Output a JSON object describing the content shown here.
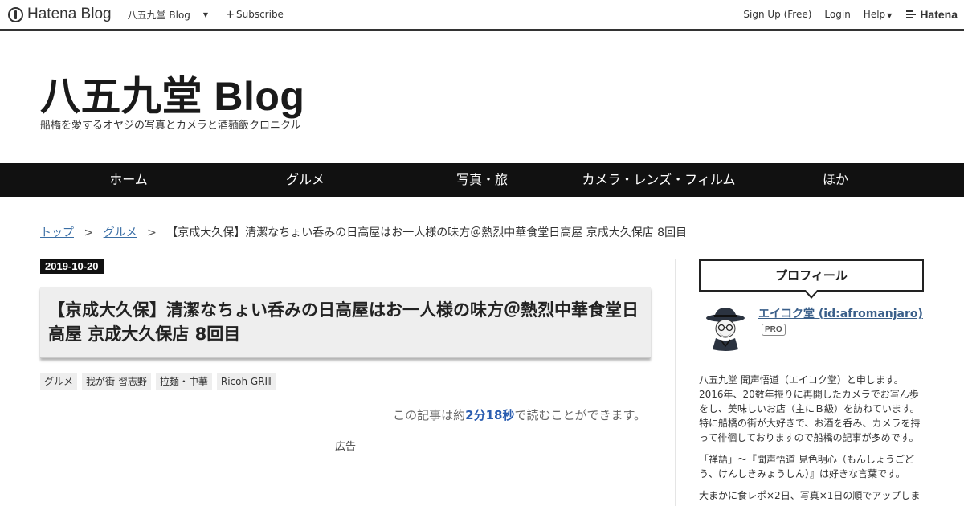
{
  "topbar": {
    "logo_text": "Hatena Blog",
    "blog_name": "八五九堂 Blog",
    "subscribe_label": "Subscribe",
    "signup_label": "Sign Up (Free)",
    "login_label": "Login",
    "help_label": "Help",
    "hatena_label": "Hatena"
  },
  "header": {
    "title": "八五九堂 Blog",
    "description": "船橋を愛するオヤジの写真とカメラと酒麺飯クロニクル"
  },
  "nav": {
    "items": [
      {
        "label": "ホーム"
      },
      {
        "label": "グルメ"
      },
      {
        "label": "写真・旅"
      },
      {
        "label": "カメラ・レンズ・フィルム"
      },
      {
        "label": "ほか"
      }
    ]
  },
  "breadcrumb": {
    "top": "トップ",
    "category": "グルメ",
    "separator": ">",
    "current": "【京成大久保】清潔なちょい呑みの日高屋はお一人様の味方＠熱烈中華食堂日高屋 京成大久保店 8回目"
  },
  "article": {
    "date": "2019-10-20",
    "title": "【京成大久保】清潔なちょい呑みの日高屋はお一人様の味方＠熱烈中華食堂日高屋 京成大久保店 8回目",
    "tags": [
      "グルメ",
      "我が街 習志野",
      "拉麺・中華",
      "Ricoh GRⅢ"
    ],
    "reading_prefix": "この記事は約",
    "reading_value": "2分18秒",
    "reading_suffix": "で読むことができます。",
    "ad_label": "広告"
  },
  "sidebar": {
    "profile_heading": "プロフィール",
    "author": "エイコク堂 (id:afromanjaro)",
    "badge": "PRO",
    "paragraphs": [
      "八五九堂 聞声悟道（エイコク堂）と申します。2016年、20数年振りに再開したカメラでお写ん歩をし、美味しいお店（主にＢ級）を訪ねています。特に船橋の街が大好きで、お酒を呑み、カメラを持って徘徊しておりますので船橋の記事が多めです。",
      "「禅語」～『聞声悟道 見色明心（もんしょうごどう、けんしきみょうしん）』は好きな言葉です。",
      "大まかに食レポ×2日、写真×1日の順でアップしま"
    ]
  },
  "colors": {
    "nav_bg": "#111111",
    "link": "#3a6ea5",
    "reading_time": "#2a5db0"
  }
}
